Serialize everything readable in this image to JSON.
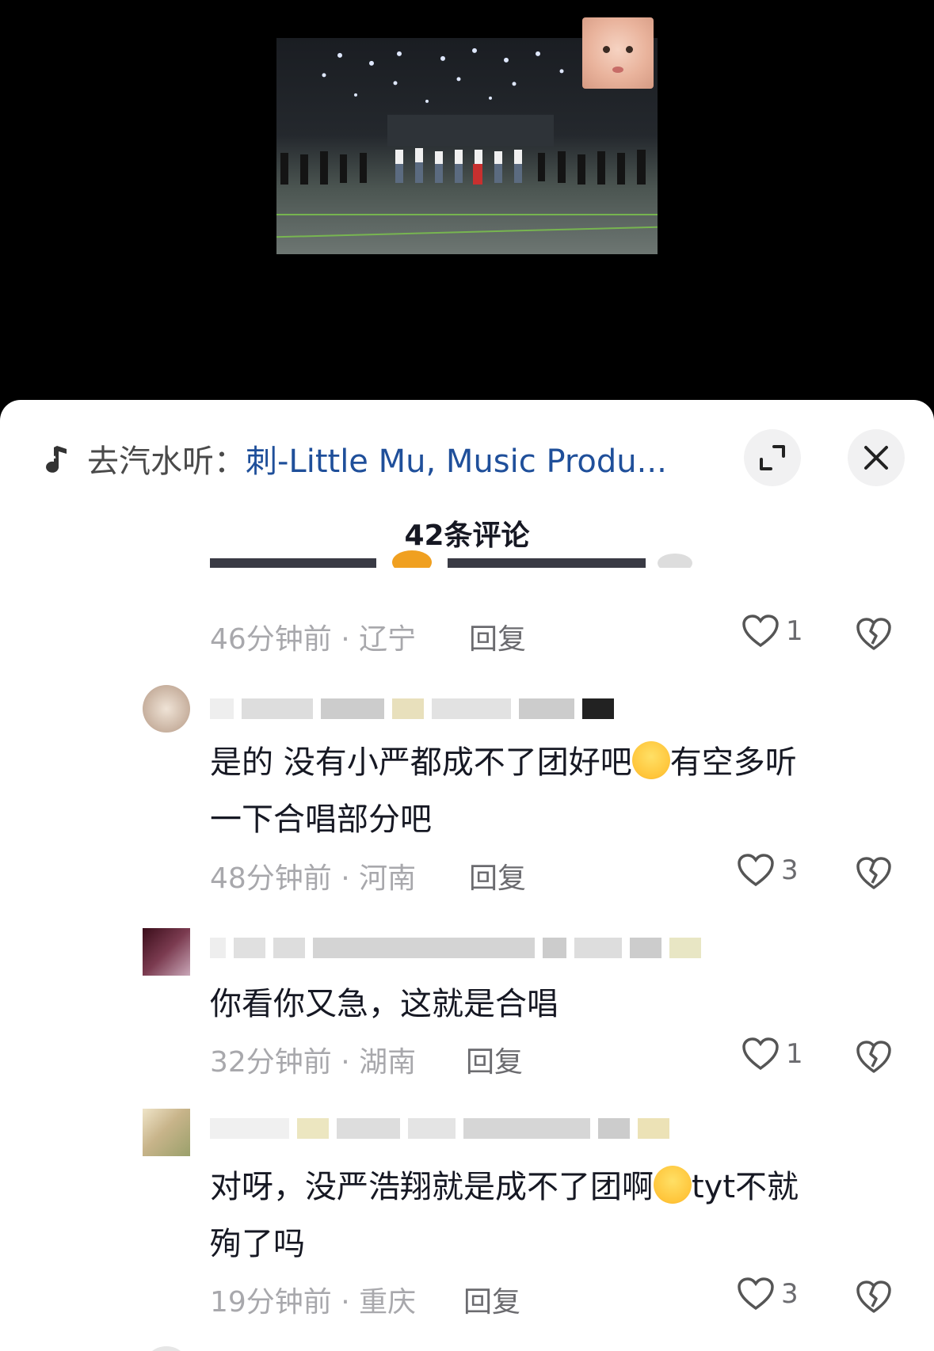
{
  "music": {
    "prefix": "去汽水听：",
    "song": "刺-Little Mu, Music Produ..."
  },
  "header": {
    "title": "42条评论"
  },
  "comments": [
    {
      "time": "46分钟前 · 辽宁",
      "reply": "回复",
      "likes": "1"
    },
    {
      "text_a": "是的 没有小严都成不了团好吧",
      "text_b": "有空多听",
      "text_c": "一下合唱部分吧",
      "time": "48分钟前 · 河南",
      "reply": "回复",
      "likes": "3"
    },
    {
      "text": "你看你又急，这就是合唱",
      "time": "32分钟前 · 湖南",
      "reply": "回复",
      "likes": "1"
    },
    {
      "text_a": "对呀，没严浩翔就是成不了团啊",
      "text_b": "tyt不就",
      "text_c": "殉了吗",
      "time": "19分钟前 · 重庆",
      "reply": "回复",
      "likes": "3"
    }
  ],
  "icons": {
    "music": "music-note-icon",
    "expand": "expand-icon",
    "close": "close-icon",
    "like": "heart-icon",
    "dislike": "broken-heart-icon"
  }
}
